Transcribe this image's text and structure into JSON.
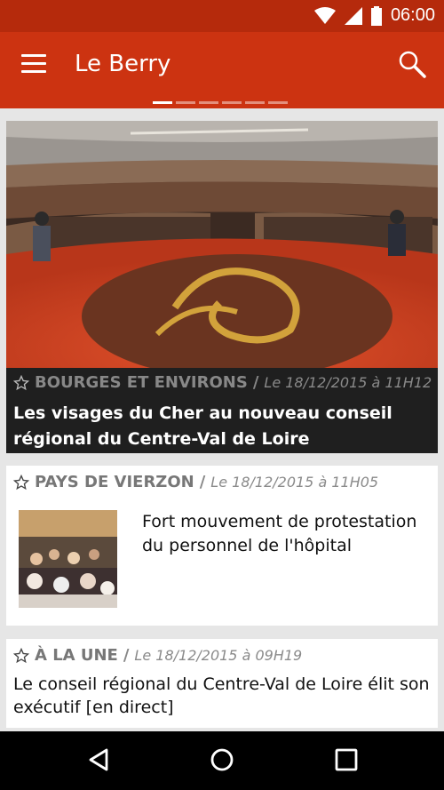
{
  "status_bar": {
    "time": "06:00"
  },
  "app_bar": {
    "title": "Le Berry",
    "page_dots": 6,
    "active_dot": 0
  },
  "articles": [
    {
      "section": "BOURGES ET ENVIRONS",
      "date": "Le 18/12/2015 à 11H12",
      "headline": "Les visages du Cher au nouveau conseil régional du Centre-Val de Loire"
    },
    {
      "section": "PAYS DE VIERZON",
      "date": "Le 18/12/2015 à 11H05",
      "headline": "Fort mouvement de protestation du personnel de l'hôpital"
    },
    {
      "section": "À LA UNE",
      "date": "Le 18/12/2015 à 09H19",
      "headline": "Le conseil régional du Centre-Val de Loire élit son exécutif [en direct]"
    }
  ],
  "icons": {
    "menu": "menu-icon",
    "search": "search-icon",
    "star": "star-outline-icon",
    "back": "back-triangle-icon",
    "home": "home-circle-icon",
    "recents": "recents-square-icon"
  },
  "colors": {
    "status_bar": "#b52a0c",
    "app_bar": "#cc3311",
    "caption_bg": "#1f1f1f"
  }
}
